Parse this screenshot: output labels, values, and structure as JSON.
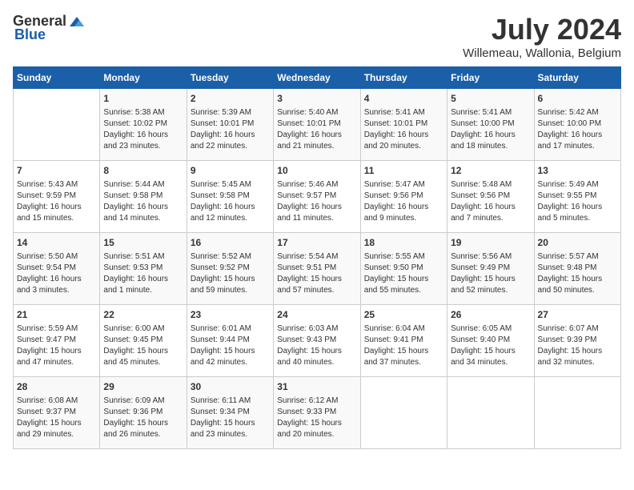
{
  "header": {
    "logo_general": "General",
    "logo_blue": "Blue",
    "month_title": "July 2024",
    "subtitle": "Willemeau, Wallonia, Belgium"
  },
  "days_of_week": [
    "Sunday",
    "Monday",
    "Tuesday",
    "Wednesday",
    "Thursday",
    "Friday",
    "Saturday"
  ],
  "weeks": [
    [
      {
        "day": "",
        "info": ""
      },
      {
        "day": "1",
        "info": "Sunrise: 5:38 AM\nSunset: 10:02 PM\nDaylight: 16 hours\nand 23 minutes."
      },
      {
        "day": "2",
        "info": "Sunrise: 5:39 AM\nSunset: 10:01 PM\nDaylight: 16 hours\nand 22 minutes."
      },
      {
        "day": "3",
        "info": "Sunrise: 5:40 AM\nSunset: 10:01 PM\nDaylight: 16 hours\nand 21 minutes."
      },
      {
        "day": "4",
        "info": "Sunrise: 5:41 AM\nSunset: 10:01 PM\nDaylight: 16 hours\nand 20 minutes."
      },
      {
        "day": "5",
        "info": "Sunrise: 5:41 AM\nSunset: 10:00 PM\nDaylight: 16 hours\nand 18 minutes."
      },
      {
        "day": "6",
        "info": "Sunrise: 5:42 AM\nSunset: 10:00 PM\nDaylight: 16 hours\nand 17 minutes."
      }
    ],
    [
      {
        "day": "7",
        "info": "Sunrise: 5:43 AM\nSunset: 9:59 PM\nDaylight: 16 hours\nand 15 minutes."
      },
      {
        "day": "8",
        "info": "Sunrise: 5:44 AM\nSunset: 9:58 PM\nDaylight: 16 hours\nand 14 minutes."
      },
      {
        "day": "9",
        "info": "Sunrise: 5:45 AM\nSunset: 9:58 PM\nDaylight: 16 hours\nand 12 minutes."
      },
      {
        "day": "10",
        "info": "Sunrise: 5:46 AM\nSunset: 9:57 PM\nDaylight: 16 hours\nand 11 minutes."
      },
      {
        "day": "11",
        "info": "Sunrise: 5:47 AM\nSunset: 9:56 PM\nDaylight: 16 hours\nand 9 minutes."
      },
      {
        "day": "12",
        "info": "Sunrise: 5:48 AM\nSunset: 9:56 PM\nDaylight: 16 hours\nand 7 minutes."
      },
      {
        "day": "13",
        "info": "Sunrise: 5:49 AM\nSunset: 9:55 PM\nDaylight: 16 hours\nand 5 minutes."
      }
    ],
    [
      {
        "day": "14",
        "info": "Sunrise: 5:50 AM\nSunset: 9:54 PM\nDaylight: 16 hours\nand 3 minutes."
      },
      {
        "day": "15",
        "info": "Sunrise: 5:51 AM\nSunset: 9:53 PM\nDaylight: 16 hours\nand 1 minute."
      },
      {
        "day": "16",
        "info": "Sunrise: 5:52 AM\nSunset: 9:52 PM\nDaylight: 15 hours\nand 59 minutes."
      },
      {
        "day": "17",
        "info": "Sunrise: 5:54 AM\nSunset: 9:51 PM\nDaylight: 15 hours\nand 57 minutes."
      },
      {
        "day": "18",
        "info": "Sunrise: 5:55 AM\nSunset: 9:50 PM\nDaylight: 15 hours\nand 55 minutes."
      },
      {
        "day": "19",
        "info": "Sunrise: 5:56 AM\nSunset: 9:49 PM\nDaylight: 15 hours\nand 52 minutes."
      },
      {
        "day": "20",
        "info": "Sunrise: 5:57 AM\nSunset: 9:48 PM\nDaylight: 15 hours\nand 50 minutes."
      }
    ],
    [
      {
        "day": "21",
        "info": "Sunrise: 5:59 AM\nSunset: 9:47 PM\nDaylight: 15 hours\nand 47 minutes."
      },
      {
        "day": "22",
        "info": "Sunrise: 6:00 AM\nSunset: 9:45 PM\nDaylight: 15 hours\nand 45 minutes."
      },
      {
        "day": "23",
        "info": "Sunrise: 6:01 AM\nSunset: 9:44 PM\nDaylight: 15 hours\nand 42 minutes."
      },
      {
        "day": "24",
        "info": "Sunrise: 6:03 AM\nSunset: 9:43 PM\nDaylight: 15 hours\nand 40 minutes."
      },
      {
        "day": "25",
        "info": "Sunrise: 6:04 AM\nSunset: 9:41 PM\nDaylight: 15 hours\nand 37 minutes."
      },
      {
        "day": "26",
        "info": "Sunrise: 6:05 AM\nSunset: 9:40 PM\nDaylight: 15 hours\nand 34 minutes."
      },
      {
        "day": "27",
        "info": "Sunrise: 6:07 AM\nSunset: 9:39 PM\nDaylight: 15 hours\nand 32 minutes."
      }
    ],
    [
      {
        "day": "28",
        "info": "Sunrise: 6:08 AM\nSunset: 9:37 PM\nDaylight: 15 hours\nand 29 minutes."
      },
      {
        "day": "29",
        "info": "Sunrise: 6:09 AM\nSunset: 9:36 PM\nDaylight: 15 hours\nand 26 minutes."
      },
      {
        "day": "30",
        "info": "Sunrise: 6:11 AM\nSunset: 9:34 PM\nDaylight: 15 hours\nand 23 minutes."
      },
      {
        "day": "31",
        "info": "Sunrise: 6:12 AM\nSunset: 9:33 PM\nDaylight: 15 hours\nand 20 minutes."
      },
      {
        "day": "",
        "info": ""
      },
      {
        "day": "",
        "info": ""
      },
      {
        "day": "",
        "info": ""
      }
    ]
  ]
}
